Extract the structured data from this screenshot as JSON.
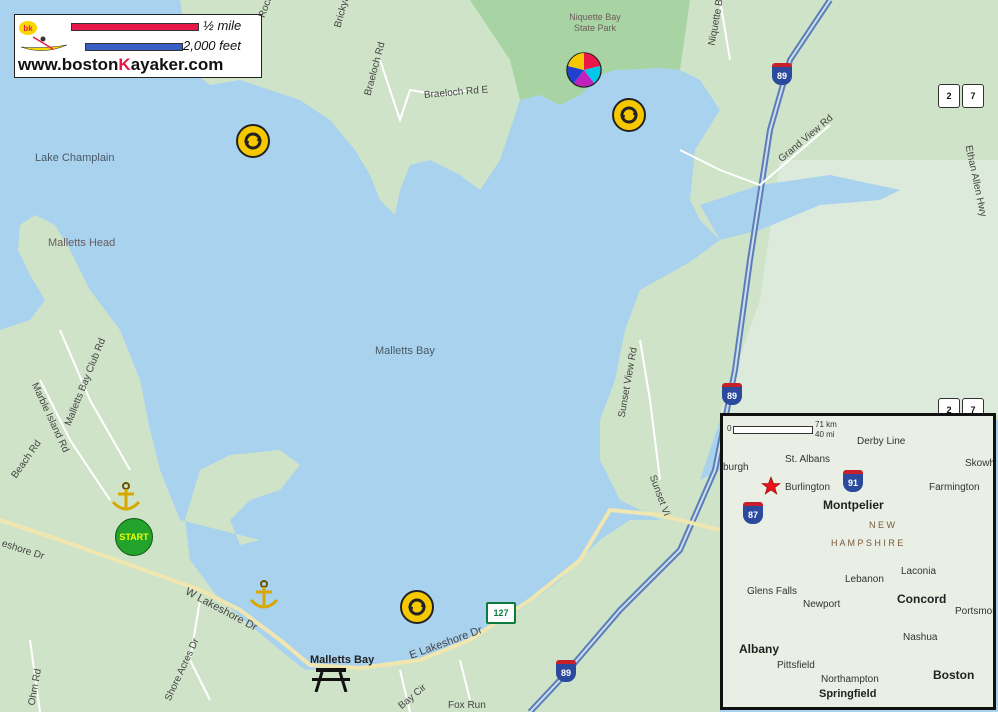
{
  "logo": {
    "url": "www.bostonKayaker.com",
    "url_a": "www.boston",
    "url_b": "K",
    "url_c": "ayaker.com",
    "badge": "bk",
    "scale_mile": "½ mile",
    "scale_feet": "2,000 feet"
  },
  "map_labels": {
    "lake_champlain": "Lake Champlain",
    "malletts_head": "Malletts Head",
    "malletts_bay": "Malletts Bay",
    "niquette_park": "Niquette Bay State Park",
    "brickyard_rd": "Brickyard",
    "rock_point": "Rock P",
    "braeloch_rd": "Braeloch Rd",
    "braeloch_rd_e": "Braeloch Rd E",
    "niquette_bay_rd": "Niquette Bay Rd",
    "grand_view_rd": "Grand View Rd",
    "ethan_allen": "Ethan Allen Hwy",
    "sunset_view_rd": "Sunset View Rd",
    "sunset_view": "Sunset Vi",
    "malletts_bay_club_rd": "Malletts Bay Club Rd",
    "marble_island_rd": "Marble Island Rd",
    "beach_rd": "Beach Rd",
    "lakeshore_dr_w_edge": "eshore Dr",
    "w_lakeshore_dr": "W Lakeshore Dr",
    "e_lakeshore_dr": "E Lakeshore Dr",
    "shore_acres_dr": "Shore Acres Dr",
    "bay_cir": "Bay Cir",
    "fox_run": "Fox Run",
    "ohm_rd": "Ohm Rd",
    "malletts_bay_town": "Malletts Bay"
  },
  "shields": {
    "i89_top": "89",
    "i89_mid": "89",
    "i89_bottom": "89",
    "us2_top": "2",
    "us7_top": "7",
    "us2_mid": "2",
    "us7_mid": "7",
    "vt127": "127"
  },
  "markers": {
    "start": "START"
  },
  "inset": {
    "scale_km": "71 km",
    "scale_mi": "40 mi",
    "scale_zero": "0",
    "labels": {
      "derby_line": "Derby Line",
      "st_albans": "St. Albans",
      "plattsburgh": "burgh",
      "burlington": "Burlington",
      "montpelier": "Montpelier",
      "skowhegan": "Skowhe",
      "farmington": "Farmington",
      "new": "N E W",
      "hampshire": "H A M P S H I R E",
      "lebanon": "Lebanon",
      "laconia": "Laconia",
      "glens_falls": "Glens Falls",
      "newport": "Newport",
      "concord": "Concord",
      "portsmouth": "Portsmou",
      "nashua": "Nashua",
      "albany": "Albany",
      "pittsfield": "Pittsfield",
      "northampton": "Northampton",
      "springfield": "Springfield",
      "boston": "Boston"
    },
    "shields": {
      "i91": "91",
      "i87": "87"
    }
  },
  "colors": {
    "water": "#a9d2ee",
    "land": "#cfe3c9",
    "park": "#9fcf9a",
    "interstate": "#5a7fb8",
    "marker_yellow": "#f6c800",
    "start_green": "#23a32c",
    "logo_red": "#e8184a",
    "logo_blue": "#3a5fc4"
  }
}
